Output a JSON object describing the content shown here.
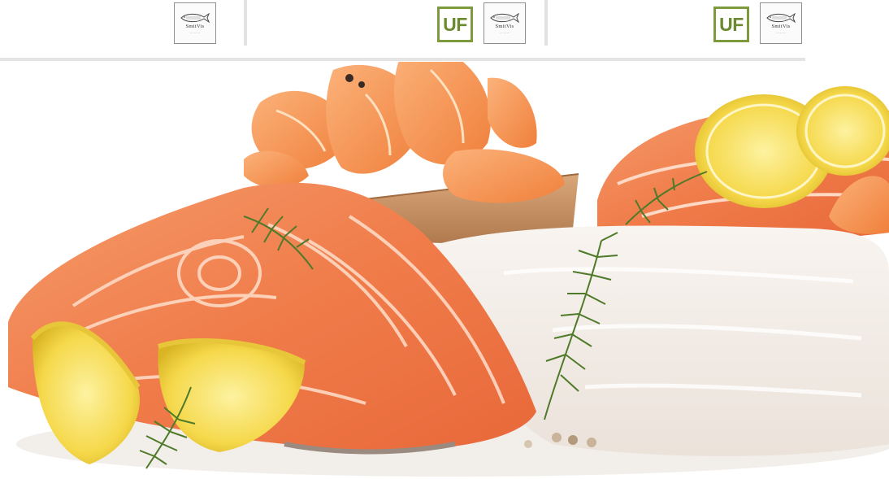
{
  "logos": [
    {
      "brand": "SmitVis",
      "icon": "fish-logo-icon"
    },
    {
      "brand": "SmitVis",
      "icon": "fish-logo-icon"
    },
    {
      "brand": "SmitVis",
      "icon": "fish-logo-icon"
    }
  ],
  "badges": [
    {
      "label": "UF"
    },
    {
      "label": "UF"
    }
  ],
  "colors": {
    "badge_green": "#7d9a3c",
    "salmon": "#f07c4a",
    "lemon": "#f5d84a",
    "white_fish": "#f4f0ec",
    "dill": "#4f7a2a",
    "divider": "#e2e2e2"
  },
  "photo": {
    "icon": "seafood-photo"
  }
}
